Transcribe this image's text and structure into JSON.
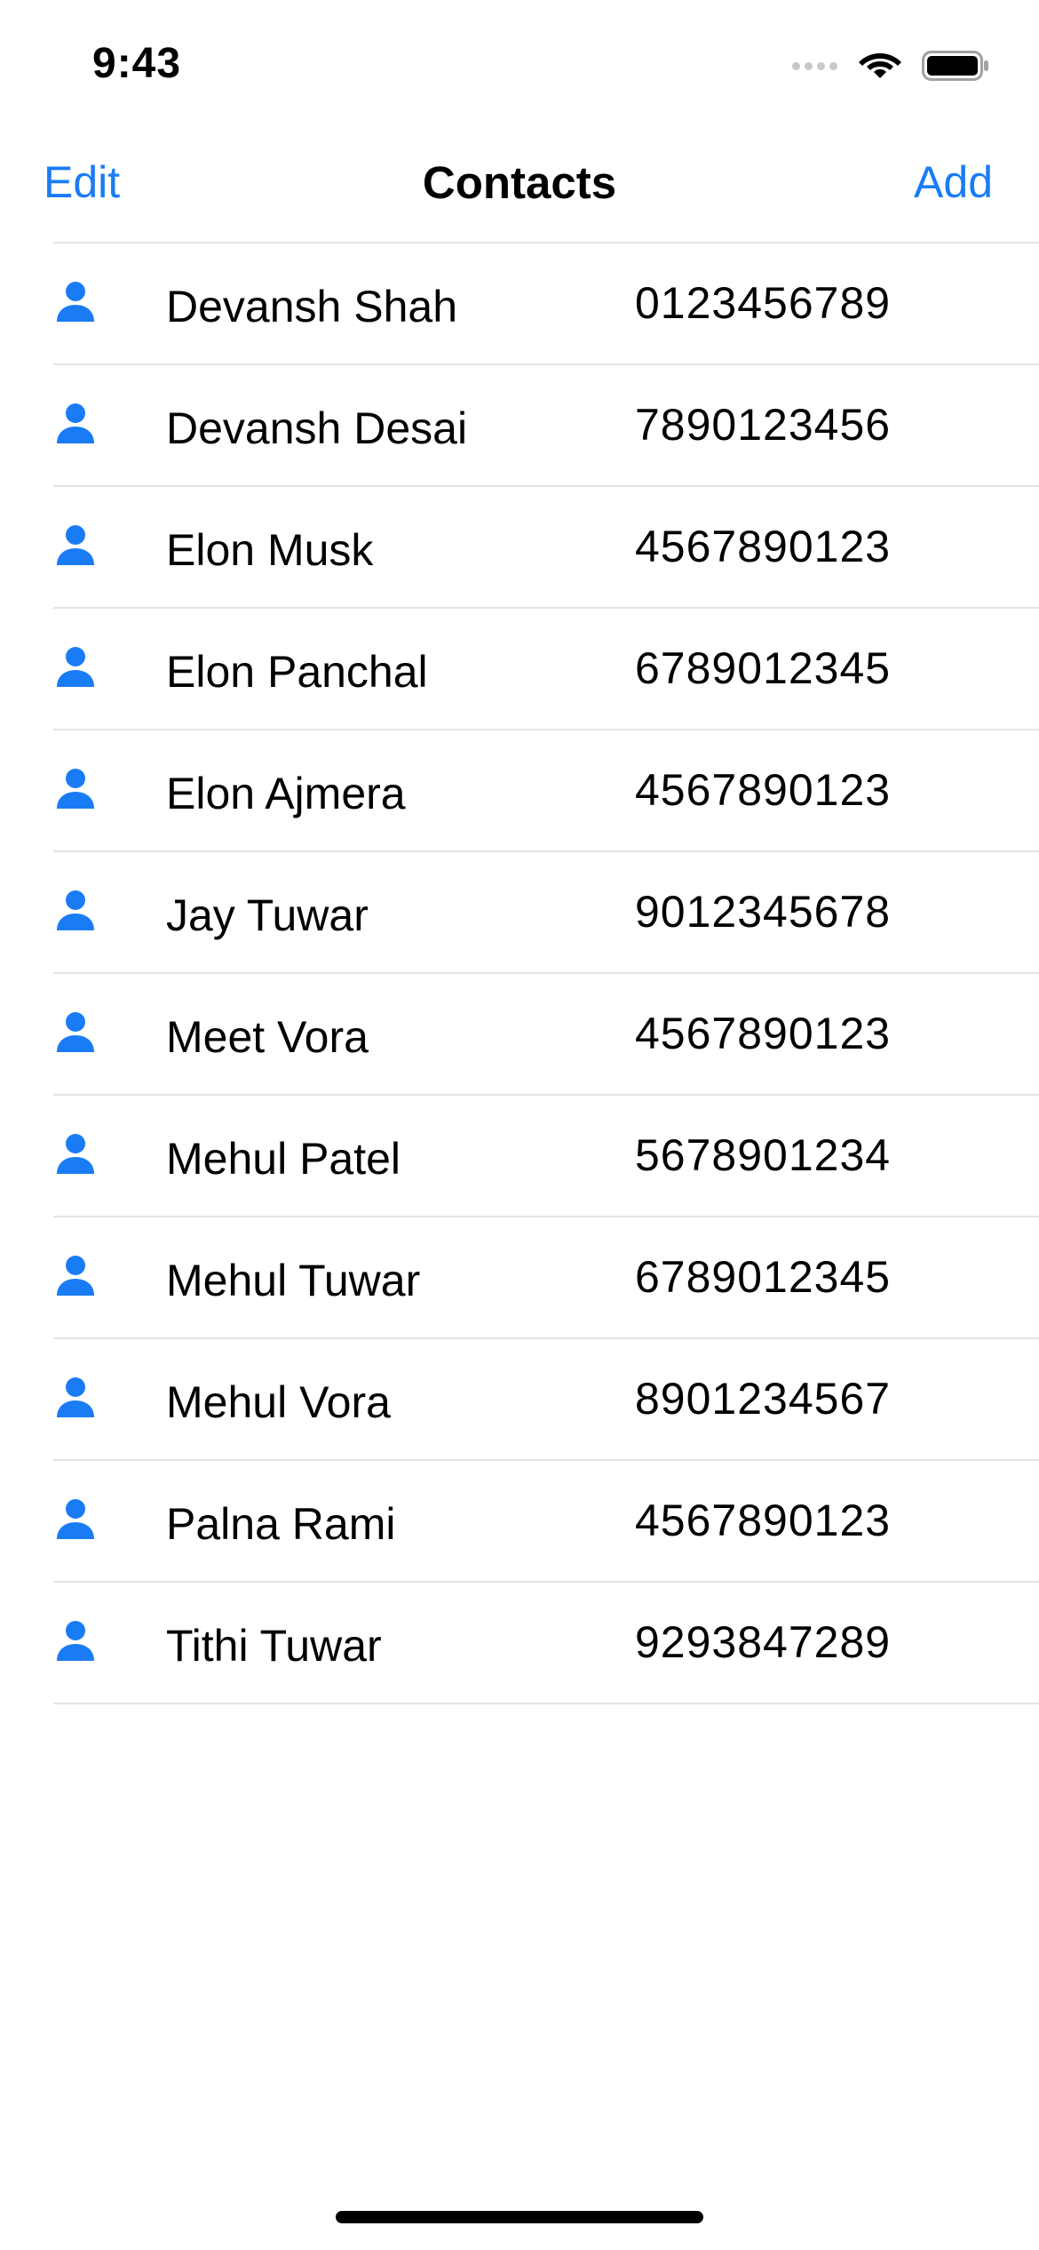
{
  "status_bar": {
    "time": "9:43"
  },
  "nav": {
    "edit_label": "Edit",
    "title": "Contacts",
    "add_label": "Add"
  },
  "colors": {
    "accent": "#1a7cf5",
    "separator": "#e3e3e6"
  },
  "row_icon": "person-fill-icon",
  "contacts": [
    {
      "name": "Devansh Shah",
      "phone": "0123456789"
    },
    {
      "name": "Devansh Desai",
      "phone": "7890123456"
    },
    {
      "name": "Elon Musk",
      "phone": "4567890123"
    },
    {
      "name": "Elon Panchal",
      "phone": "6789012345"
    },
    {
      "name": "Elon Ajmera",
      "phone": "4567890123"
    },
    {
      "name": "Jay Tuwar",
      "phone": "9012345678"
    },
    {
      "name": "Meet Vora",
      "phone": "4567890123"
    },
    {
      "name": "Mehul Patel",
      "phone": "5678901234"
    },
    {
      "name": "Mehul Tuwar",
      "phone": "6789012345"
    },
    {
      "name": "Mehul Vora",
      "phone": "8901234567"
    },
    {
      "name": "Palna Rami",
      "phone": "4567890123"
    },
    {
      "name": "Tithi Tuwar",
      "phone": "9293847289"
    }
  ]
}
